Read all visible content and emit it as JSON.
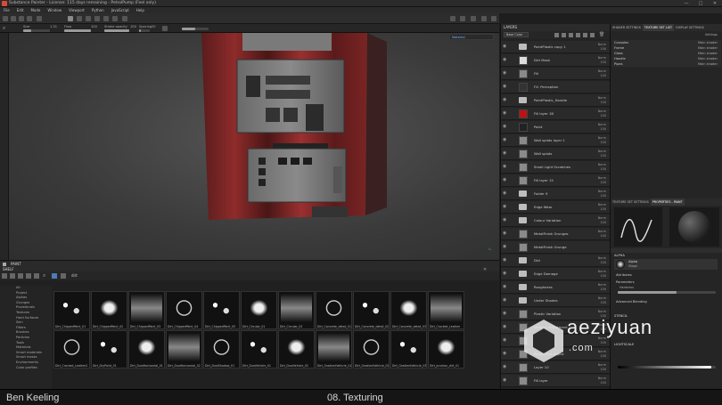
{
  "titlebar": {
    "title": "Substance Painter - License: 115 days remaining - PetrolPump (Feel only)",
    "min": "—",
    "max": "□",
    "close": "✕"
  },
  "menu": [
    "File",
    "Edit",
    "Mode",
    "Window",
    "Viewport",
    "Python",
    "JavaScript",
    "Help"
  ],
  "propbar": {
    "size_label": "Size",
    "size_value": "1.31",
    "flow_label": "Flow",
    "flow_value": "100",
    "stroke_label": "Stroke opacity",
    "stroke_value": "100",
    "spacing_label": "Spacing",
    "spacing_value": "20"
  },
  "viewport": {
    "material_dropdown": "Material"
  },
  "shelf": {
    "title": "SHELF",
    "paint_tab": "PAINT",
    "search_value": "dirt",
    "categories": [
      "All",
      "Project",
      "Alphas",
      "Grunges",
      "Procedurals",
      "Textures",
      "Hard Surfaces",
      "Skin",
      "Filters",
      "Brushes",
      "Particles",
      "Tools",
      "Materials",
      "Smart materials",
      "Smart masks",
      "Environments",
      "Color profiles"
    ],
    "items": [
      {
        "name": "Dirt_ChippedPaint_01"
      },
      {
        "name": "Dirt_ChippedPaint_02"
      },
      {
        "name": "Dirt_ChippedPaint_03"
      },
      {
        "name": "Dirt_ChippedPaint_04"
      },
      {
        "name": "Dirt_ChippedPaint_05"
      },
      {
        "name": "Dirt_Circular_01"
      },
      {
        "name": "Dirt_Circular_02"
      },
      {
        "name": "Dirt_Concrete_detail_01"
      },
      {
        "name": "Dirt_Concrete_detail_02"
      },
      {
        "name": "Dirt_Concrete_detail_03"
      },
      {
        "name": "Dirt_Cracked_Leather"
      },
      {
        "name": "Dirt_Cracked_Leather2"
      },
      {
        "name": "Dirt_DryPaint_01"
      },
      {
        "name": "Dirt_DustHorizontal_01"
      },
      {
        "name": "Dirt_DustHorizontal_02"
      },
      {
        "name": "Dirt_DustShadow_01"
      },
      {
        "name": "Dirt_DustVehicle_01"
      },
      {
        "name": "Dirt_DustVehicle_02"
      },
      {
        "name": "Dirt_GradientVehicle_01"
      },
      {
        "name": "Dirt_GradientVehicle_02"
      },
      {
        "name": "Dirt_GradientVehicle_03"
      },
      {
        "name": "Dirt_Junction_dirt_01"
      }
    ]
  },
  "layers": {
    "title": "LAYERS",
    "channel": "Base Color",
    "rows": [
      {
        "name": "PaintPlastic copy 1",
        "type": "folder",
        "blend": "Norm",
        "opacity": "100"
      },
      {
        "name": "Dirt Mask",
        "type": "mask",
        "blend": "Norm",
        "opacity": "100"
      },
      {
        "name": "Fill",
        "type": "fill",
        "blend": "Norm",
        "opacity": "100"
      },
      {
        "name": "FX: Perception",
        "type": "fx",
        "blend": "",
        "opacity": ""
      },
      {
        "name": "PaintPlastic_Handle",
        "type": "folder",
        "blend": "Norm",
        "opacity": "100"
      },
      {
        "name": "Fill layer 1B",
        "type": "red",
        "blend": "Norm",
        "opacity": "100"
      },
      {
        "name": "Paint",
        "type": "paint",
        "blend": "Norm",
        "opacity": "100"
      },
      {
        "name": "Wall splats layer 1",
        "type": "fill",
        "blend": "Norm",
        "opacity": "100"
      },
      {
        "name": "Wall splats",
        "type": "fill",
        "blend": "Norm",
        "opacity": "100"
      },
      {
        "name": "Small Light Scratches",
        "type": "fill",
        "blend": "Norm",
        "opacity": "100"
      },
      {
        "name": "Fill layer 15",
        "type": "fill",
        "blend": "Norm",
        "opacity": "100"
      },
      {
        "name": "Folder 9",
        "type": "folder",
        "blend": "Norm",
        "opacity": "100"
      },
      {
        "name": "Edge Wear",
        "type": "folder",
        "blend": "Norm",
        "opacity": "100"
      },
      {
        "name": "Colour Variation",
        "type": "folder",
        "blend": "Norm",
        "opacity": "100"
      },
      {
        "name": "MetalFinish Grunges",
        "type": "fill",
        "blend": "Norm",
        "opacity": "100"
      },
      {
        "name": "MetalFinish Grunge",
        "type": "fill",
        "blend": "",
        "opacity": ""
      },
      {
        "name": "Dirt",
        "type": "folder",
        "blend": "Norm",
        "opacity": "100"
      },
      {
        "name": "Edge Damage",
        "type": "folder",
        "blend": "Norm",
        "opacity": "100"
      },
      {
        "name": "Roughness",
        "type": "folder",
        "blend": "Norm",
        "opacity": "100"
      },
      {
        "name": "Under Shades",
        "type": "folder",
        "blend": "Norm",
        "opacity": "100"
      },
      {
        "name": "Plastic Variation",
        "type": "fill",
        "blend": "Norm",
        "opacity": "100"
      },
      {
        "name": "Metallic Adjustment",
        "type": "fill",
        "blend": "Norm",
        "opacity": "100"
      },
      {
        "name": "Base",
        "type": "fill",
        "blend": "Norm",
        "opacity": "100"
      },
      {
        "name": "Roughness Adjust",
        "type": "fill",
        "blend": "Norm",
        "opacity": "100"
      },
      {
        "name": "Layer 10",
        "type": "fill",
        "blend": "Norm",
        "opacity": "100"
      },
      {
        "name": "Fill layer",
        "type": "fill",
        "blend": "Norm",
        "opacity": "100"
      }
    ]
  },
  "right": {
    "top_tabs": [
      "SHADER SETTINGS",
      "TEXTURE SET LIST",
      "DISPLAY SETTINGS"
    ],
    "settings_label": "Settings",
    "texture_sets": [
      {
        "name": "Consoles",
        "shader": "Main shader"
      },
      {
        "name": "Frame",
        "shader": "Main shader"
      },
      {
        "name": "Glass",
        "shader": "Main shader"
      },
      {
        "name": "Handle",
        "shader": "Main shader"
      },
      {
        "name": "Pipes",
        "shader": "Main shader"
      }
    ],
    "mid_tabs": [
      "TEXTURE SET SETTINGS",
      "PROPERTIES - PAINT"
    ],
    "alpha_title": "ALPHA",
    "alpha_name": "Alpha",
    "alpha_sub": "Shape",
    "attributes": "Attributes",
    "parameters": "Parameters",
    "hardness_label": "Hardness",
    "advanced": "Advanced Blending",
    "stencil": "STENCIL",
    "lightscale": "LIGHTSCALE"
  },
  "footer": {
    "author": "Ben Keeling",
    "lesson": "08. Texturing"
  },
  "watermark": {
    "big": "aeziyuan",
    "small": ".com"
  }
}
